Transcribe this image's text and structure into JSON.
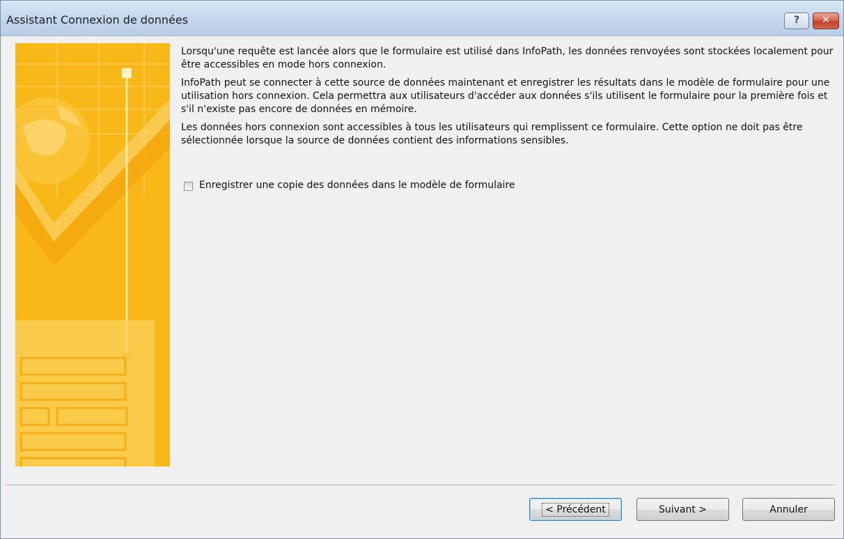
{
  "window": {
    "title": "Assistant Connexion de données",
    "help_label": "?",
    "close_label": "✕"
  },
  "content": {
    "paragraphs": [
      "Lorsqu'une requête est lancée alors que le formulaire est utilisé dans InfoPath, les données renvoyées sont stockées localement pour être accessibles en mode hors connexion.",
      "InfoPath peut se connecter à cette source de données maintenant et enregistrer les résultats dans le modèle de formulaire pour une utilisation hors connexion. Cela permettra aux utilisateurs d'accéder aux données s'ils utilisent le formulaire pour la première fois et s'il n'existe pas encore de données en mémoire.",
      "Les données hors connexion sont accessibles à tous les utilisateurs qui remplissent ce formulaire. Cette option ne doit pas être sélectionnée lorsque la source de données contient des informations sensibles."
    ],
    "checkbox_label": "Enregistrer une copie des données dans le modèle de formulaire",
    "checkbox_checked": false
  },
  "buttons": {
    "previous": "< Précédent",
    "next": "Suivant >",
    "cancel": "Annuler"
  }
}
